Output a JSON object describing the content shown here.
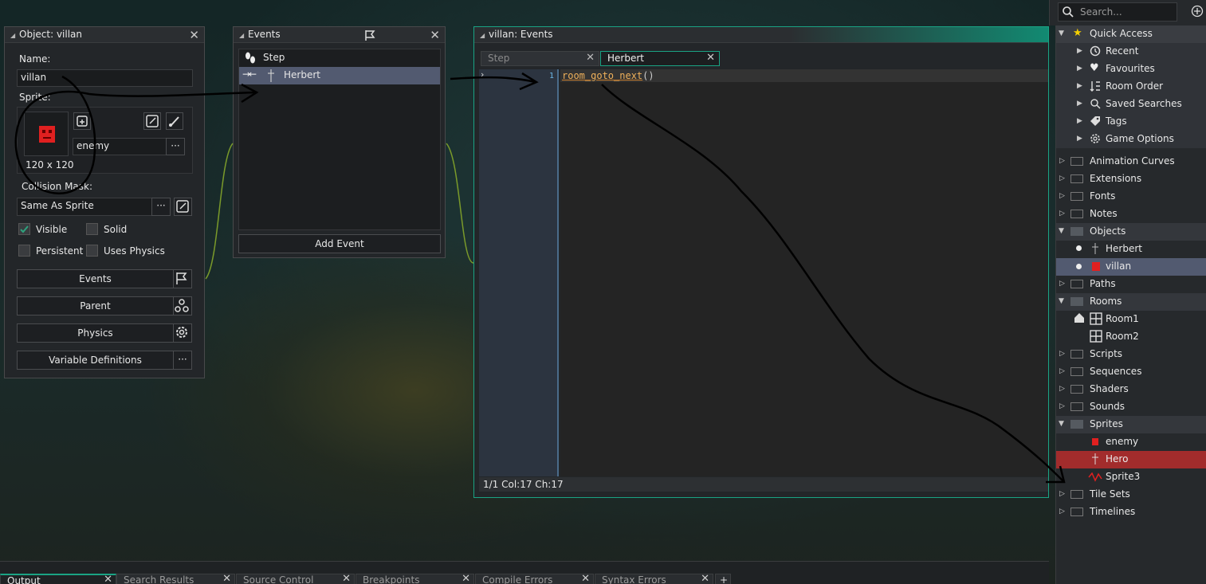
{
  "object_panel": {
    "title": "Object: villan",
    "name_label": "Name:",
    "name_value": "villan",
    "sprite_label": "Sprite:",
    "sprite_name": "enemy",
    "sprite_size": "120 x 120",
    "collision_label": "Collision Mask:",
    "collision_value": "Same As Sprite",
    "visible_label": "Visible",
    "solid_label": "Solid",
    "persistent_label": "Persistent",
    "uses_physics_label": "Uses Physics",
    "events_btn": "Events",
    "parent_btn": "Parent",
    "physics_btn": "Physics",
    "variable_defs_btn": "Variable Definitions",
    "more_label": "···",
    "visible_checked": true,
    "solid_checked": false,
    "persistent_checked": false,
    "uses_physics_checked": false
  },
  "events_panel": {
    "title": "Events",
    "items": [
      {
        "label": "Step"
      },
      {
        "label": "Herbert"
      }
    ],
    "add_event_btn": "Add Event"
  },
  "code_panel": {
    "title": "villan: Events",
    "tabs": [
      {
        "label": "Step",
        "active": false
      },
      {
        "label": "Herbert",
        "active": true
      }
    ],
    "line_number": "1",
    "code_fn": "room_goto_next",
    "code_parens": "()",
    "status": "1/1 Col:17 Ch:17"
  },
  "asset_browser": {
    "search_placeholder": "Search...",
    "quick_access": "Quick Access",
    "quick_items": [
      "Recent",
      "Favourites",
      "Room Order",
      "Saved Searches",
      "Tags",
      "Game Options"
    ],
    "groups": [
      "Animation Curves",
      "Extensions",
      "Fonts",
      "Notes",
      "Objects",
      "Herbert",
      "villan",
      "Paths",
      "Rooms",
      "Room1",
      "Room2",
      "Scripts",
      "Sequences",
      "Shaders",
      "Sounds",
      "Sprites",
      "enemy",
      "Hero",
      "Sprite3",
      "Tile Sets",
      "Timelines"
    ]
  },
  "output_tabs": [
    "Output",
    "Search Results",
    "Source Control",
    "Breakpoints",
    "Compile Errors",
    "Syntax Errors"
  ],
  "output_add": "+",
  "colors": {
    "accent_teal": "#1aa384",
    "selected_row": "#525a70",
    "hero_row": "#a22c2c",
    "code_fn": "#f0b15a"
  }
}
